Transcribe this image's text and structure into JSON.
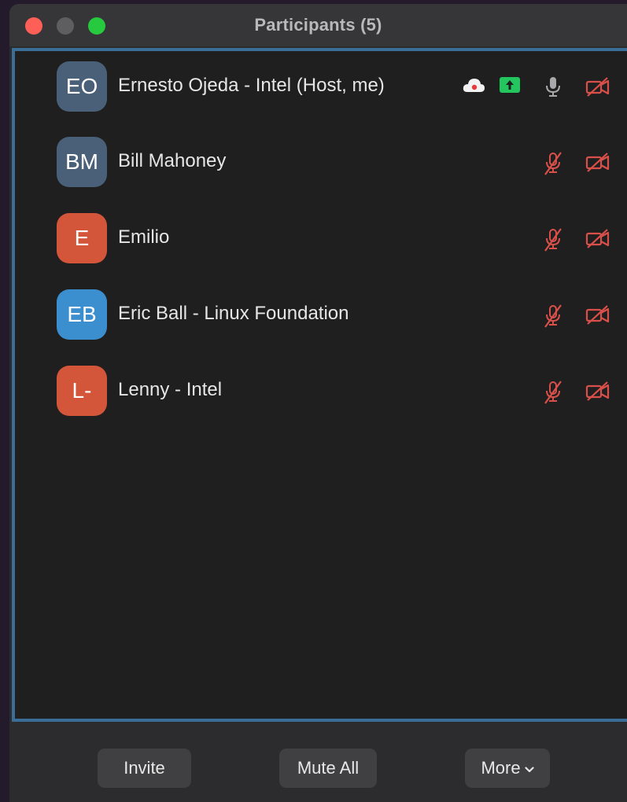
{
  "window": {
    "title": "Participants (5)"
  },
  "participants": [
    {
      "initials": "EO",
      "name": "Ernesto Ojeda - Intel (Host, me)",
      "avatar_color": "#4a6078",
      "icons": [
        "cloud-recording-icon",
        "share-screen-icon",
        "mic-icon",
        "video-off-icon"
      ],
      "mic": "on",
      "video": "off"
    },
    {
      "initials": "BM",
      "name": "Bill Mahoney",
      "avatar_color": "#4a6078",
      "icons": [
        "mic-muted-icon",
        "video-off-icon"
      ],
      "mic": "muted",
      "video": "off"
    },
    {
      "initials": "E",
      "name": "Emilio",
      "avatar_color": "#d3553a",
      "icons": [
        "mic-muted-icon",
        "video-off-icon"
      ],
      "mic": "muted",
      "video": "off"
    },
    {
      "initials": "EB",
      "name": "Eric Ball - Linux Foundation",
      "avatar_color": "#3c8fce",
      "icons": [
        "mic-muted-icon",
        "video-off-icon"
      ],
      "mic": "muted",
      "video": "off"
    },
    {
      "initials": "L-",
      "name": "Lenny - Intel",
      "avatar_color": "#d3553a",
      "icons": [
        "mic-muted-icon",
        "video-off-icon"
      ],
      "mic": "muted",
      "video": "off"
    }
  ],
  "footer": {
    "invite_label": "Invite",
    "mute_all_label": "Mute All",
    "more_label": "More"
  },
  "colors": {
    "muted_red": "#d9504a",
    "share_green": "#22c55e",
    "accent_border": "#3b6e97"
  }
}
